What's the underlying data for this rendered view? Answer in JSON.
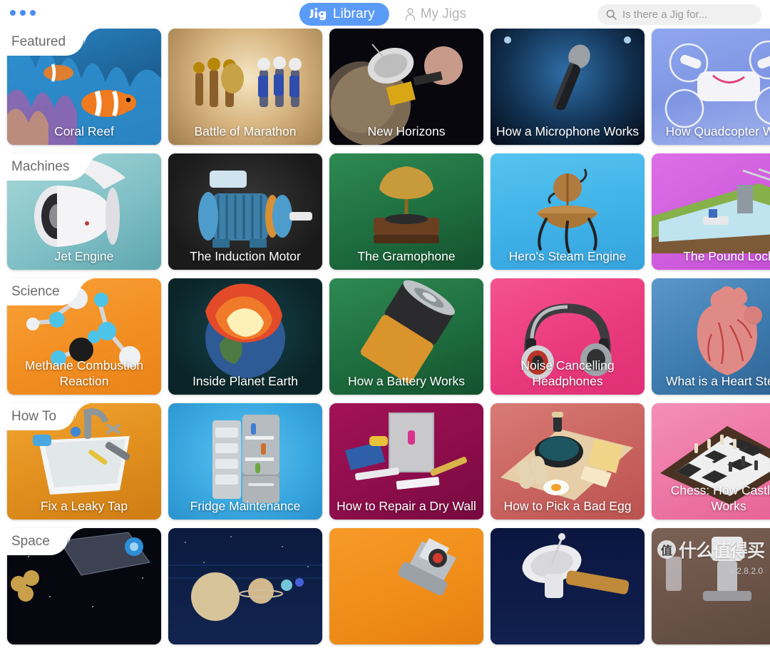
{
  "app": {
    "brand": "Jig",
    "version_label": "v 2.8.2.0",
    "watermark_badge": "值",
    "watermark_text": "什么值得买"
  },
  "header": {
    "window_dots_count": 3,
    "nav": [
      {
        "id": "library",
        "label": "Library",
        "icon": "jig-logo-icon",
        "active": true
      },
      {
        "id": "my-jigs",
        "label": "My Jigs",
        "icon": "person-icon",
        "active": false
      }
    ],
    "search": {
      "placeholder": "Is there a Jig for...",
      "value": "Is there a Jig for...",
      "icon": "search-icon"
    }
  },
  "colors": {
    "accent": "#5b9bf8",
    "nav_inactive": "#b4b4b4",
    "search_bg": "#f0f0f0",
    "category_label": "#6b6b6b",
    "card_title": "#ffffff",
    "page_bg": "#ffffff"
  },
  "rows": [
    {
      "category": "Featured",
      "cards": [
        {
          "title": "Coral Reef",
          "art": "coral-reef",
          "bg": "#1f6fae"
        },
        {
          "title": "Battle of Marathon",
          "art": "battle-marathon",
          "bg": "#c9a77a"
        },
        {
          "title": "New Horizons",
          "art": "new-horizons",
          "bg": "#0a0a12"
        },
        {
          "title": "How a Microphone Works",
          "art": "microphone",
          "bg": "#10365f"
        },
        {
          "title": "How Quadcopter Work",
          "art": "quadcopter",
          "bg": "#7f9ae8"
        }
      ]
    },
    {
      "category": "Machines",
      "cards": [
        {
          "title": "Jet Engine",
          "art": "jet-engine",
          "bg": "#86c4c8"
        },
        {
          "title": "The Induction Motor",
          "art": "induction-motor",
          "bg": "#232323"
        },
        {
          "title": "The Gramophone",
          "art": "gramophone",
          "bg": "#1f7a42"
        },
        {
          "title": "Hero's Steam Engine",
          "art": "steam-engine",
          "bg": "#4cb8ef"
        },
        {
          "title": "The Pound Lock",
          "art": "pound-lock",
          "bg": "#d265e0"
        }
      ]
    },
    {
      "category": "Science",
      "cards": [
        {
          "title": "Methane Combustion Reaction",
          "art": "methane",
          "bg": "#f5912c"
        },
        {
          "title": "Inside Planet Earth",
          "art": "planet-earth",
          "bg": "#0e2f33"
        },
        {
          "title": "How a Battery Works",
          "art": "battery",
          "bg": "#1f7a42"
        },
        {
          "title": "Noise Cancelling Headphones",
          "art": "headphones",
          "bg": "#ef3f81"
        },
        {
          "title": "What is a Heart Stent?",
          "art": "heart-stent",
          "bg": "#3f7fb5"
        }
      ]
    },
    {
      "category": "How To",
      "cards": [
        {
          "title": "Fix a Leaky Tap",
          "art": "leaky-tap",
          "bg": "#e99a25"
        },
        {
          "title": "Fridge Maintenance",
          "art": "fridge",
          "bg": "#3fb0e8"
        },
        {
          "title": "How to Repair a Dry Wall",
          "art": "dry-wall",
          "bg": "#9e1050"
        },
        {
          "title": "How to Pick a Bad Egg",
          "art": "bad-egg",
          "bg": "#cf6a6a"
        },
        {
          "title": "Chess: How Castling Works",
          "art": "chess",
          "bg": "#ee7aa8"
        }
      ]
    },
    {
      "category": "Space",
      "cards": [
        {
          "title": "",
          "art": "space-telescope",
          "bg": "#0a0a10"
        },
        {
          "title": "",
          "art": "solar-system",
          "bg": "#0e1f45"
        },
        {
          "title": "",
          "art": "rover",
          "bg": "#f5912c"
        },
        {
          "title": "",
          "art": "deep-space-dish",
          "bg": "#0d1a4a"
        },
        {
          "title": "",
          "art": "observatory",
          "bg": "#6b5247"
        }
      ]
    }
  ]
}
